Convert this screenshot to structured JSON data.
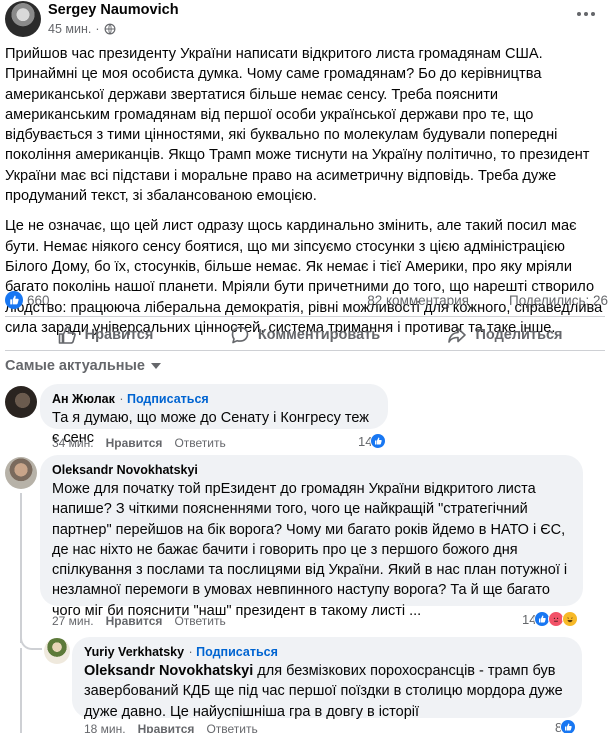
{
  "post": {
    "author": "Sergey Naumovich",
    "time": "45 мин.",
    "globe_sep": "·",
    "paragraphs": [
      "Прийшов час президенту України написати відкритого листа громадянам США. Принаймні це моя особиста думка. Чому саме громадянам? Бо до керівництва американської держави звертатися більше немає сенсу. Треба пояснити американським громадянам від першої особи української держави про те, що відбувається з тими цінностями, які буквально по молекулам будували попередні покоління американців. Якщо Трамп може тиснути на Україну політично, то президент України має всі підстави і моральне право на асиметричну відповідь. Треба дуже продуманий текст, зі збалансованою емоцією.",
      "Це не означає, що цей лист одразу щось кардинально змінить, але такий посил має бути. Немає ніякого сенсу боятися, що ми зіпсуємо стосунки з цією адміністрацією Білого Дому, бо їх, стосунків, більше немає. Як немає і тієї Америки, про яку мріяли багато поколінь нашої планети. Мріяли бути причетними до того, що нарешті створило людство: працююча ліберальна демократія, рівні можливості для кожного, справедлива сила заради універсальних цінностей, система тримання і противаг та таке інше."
    ]
  },
  "stats": {
    "likes": "660",
    "comments": "82 комментария",
    "shares": "Поделились: 26"
  },
  "actions": {
    "like": "Нравится",
    "comment": "Комментировать",
    "share": "Поделиться"
  },
  "sort_label": "Самые актуальные",
  "comments": [
    {
      "name": "Ан Жюлак",
      "follow": "Подписаться",
      "text": "Та я думаю, що може до Сенату і Конгресу теж є сенс",
      "time": "34 мин.",
      "like": "Нравится",
      "reply": "Ответить",
      "reactions": "14"
    },
    {
      "name": "Oleksandr Novokhatskyi",
      "text": "Може для початку той прЕзидент до громадян України відкритого листа напише? З чіткими поясненнями того, чого це найкращій \"стратегічний партнер\" перейшов на бік ворога? Чому ми багато років йдемо в НАТО і ЄС, де нас ніхто не бажає бачити і говорить про це з першого божого дня спілкування з послами та послицями від України. Який в нас план потужної і незламної перемоги в умовах невпинного наступу ворога? Та й ще багато чого міг би пояснити \"наш\" президент в такому листі ...",
      "time": "27 мин.",
      "like": "Нравится",
      "reply": "Ответить",
      "reactions": "14"
    },
    {
      "name": "Yuriy Verkhatsky",
      "follow": "Подписаться",
      "mention": "Oleksandr Novokhatskyi",
      "text": " для безмізкових порохосрансців - трамп був завербований КДБ ще під час першої поїздки в столицю мордора дуже дуже давно. Це найуспішніша гра в довгу в історії",
      "time": "18 мин.",
      "like": "Нравится",
      "reply": "Ответить",
      "reactions": "8"
    }
  ],
  "colors": {
    "accent": "#1877f2",
    "link": "#0064d1",
    "muted": "#65676b",
    "bubble": "#f0f2f5",
    "angry": "#f25268",
    "laugh": "#f7b928"
  }
}
